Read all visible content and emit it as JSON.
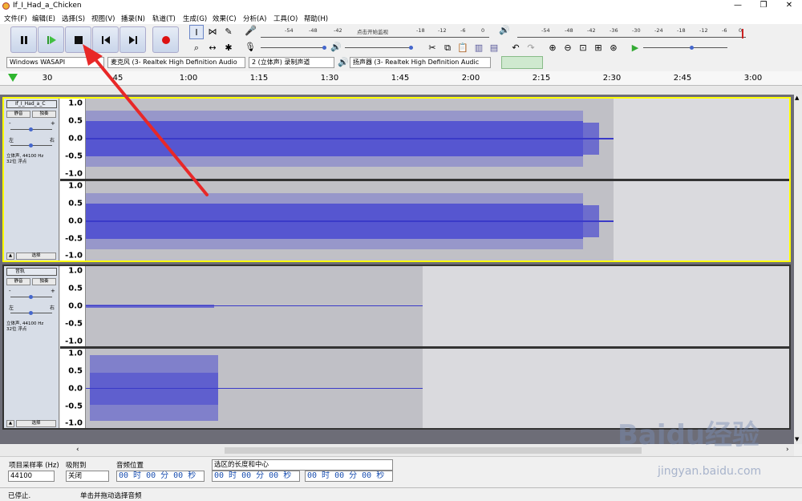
{
  "app": {
    "title": "If_I_Had_a_Chicken"
  },
  "menu": [
    "文件(F)",
    "编辑(E)",
    "选择(S)",
    "视图(V)",
    "播录(N)",
    "轨道(T)",
    "生成(G)",
    "效果(C)",
    "分析(A)",
    "工具(O)",
    "帮助(H)"
  ],
  "meters": {
    "record_scale": [
      "-54",
      "-48",
      "-42",
      "点击开始监视",
      "-18",
      "-12",
      "-6",
      "0"
    ],
    "play_scale": [
      "-54",
      "-48",
      "-42",
      "-36",
      "-30",
      "-24",
      "-18",
      "-12",
      "-6",
      "0"
    ]
  },
  "devices": {
    "host": "Windows WASAPI",
    "mic": "麦克风 (3- Realtek High Definition Audio",
    "channels": "2 (立体声) 录制声道",
    "speaker": "扬声器 (3- Realtek High Definition Audic"
  },
  "timeline": {
    "labels": [
      "30",
      "45",
      "1:00",
      "1:15",
      "1:30",
      "1:45",
      "2:00",
      "2:15",
      "2:30",
      "2:45",
      "3:00"
    ]
  },
  "tracks": [
    {
      "name": "If_I_Had_a_C",
      "mute": "静音",
      "solo": "独奏",
      "info1": "立体声, 44100 Hz",
      "info2": "32位 浮点",
      "select": "选择",
      "ylabels": [
        "1.0",
        "0.5",
        "0.0",
        "-0.5",
        "-1.0"
      ]
    },
    {
      "name": "音轨",
      "mute": "静音",
      "solo": "独奏",
      "info1": "立体声, 44100 Hz",
      "info2": "32位 浮点",
      "select": "选择",
      "ylabels": [
        "1.0",
        "0.5",
        "0.0",
        "-0.5",
        "-1.0"
      ]
    }
  ],
  "selection": {
    "rate_label": "项目采样率 (Hz)",
    "rate_value": "44100",
    "snap_label": "吸附到",
    "snap_value": "关闭",
    "pos_label": "音频位置",
    "pos_value": "00 时 00 分 00 秒",
    "sel_label": "选区的长度和中心",
    "sel_start": "00 时 00 分 00 秒",
    "sel_end": "00 时 00 分 00 秒"
  },
  "status": {
    "left": "已停止.",
    "right": "单击并拖动选择音频"
  },
  "watermark": {
    "main": "Baidu经验",
    "sub": "jingyan.baidu.com"
  }
}
